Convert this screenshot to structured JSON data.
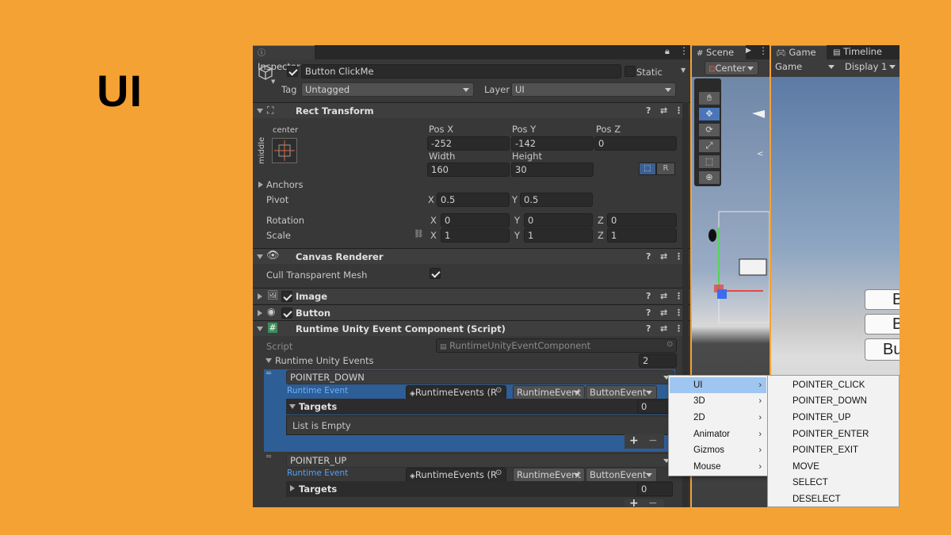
{
  "slide": {
    "title": "UI"
  },
  "inspector": {
    "tab_label": "Inspector",
    "object_name": "Button ClickMe",
    "static_label": "Static",
    "tag_label": "Tag",
    "tag_value": "Untagged",
    "layer_label": "Layer",
    "layer_value": "UI"
  },
  "rect_transform": {
    "title": "Rect Transform",
    "anchor_h": "center",
    "anchor_v": "middle",
    "pos_x_label": "Pos X",
    "pos_x": "-252",
    "pos_y_label": "Pos Y",
    "pos_y": "-142",
    "pos_z_label": "Pos Z",
    "pos_z": "0",
    "width_label": "Width",
    "width": "160",
    "height_label": "Height",
    "height": "30",
    "r_button": "R",
    "anchors_label": "Anchors",
    "pivot_label": "Pivot",
    "pivot_x": "0.5",
    "pivot_y": "0.5",
    "rotation_label": "Rotation",
    "rot_x": "0",
    "rot_y": "0",
    "rot_z": "0",
    "scale_label": "Scale",
    "scale_x": "1",
    "scale_y": "1",
    "scale_z": "1",
    "x": "X",
    "y": "Y",
    "z": "Z"
  },
  "canvas_renderer": {
    "title": "Canvas Renderer",
    "cull_label": "Cull Transparent Mesh"
  },
  "image_component": {
    "title": "Image"
  },
  "button_component": {
    "title": "Button"
  },
  "runtime_component": {
    "title": "Runtime Unity Event Component (Script)",
    "script_label": "Script",
    "script_value": "RuntimeUnityEventComponent",
    "events_label": "Runtime Unity Events",
    "events_count": "2",
    "events": [
      {
        "type": "POINTER_DOWN",
        "runtime_event_label": "Runtime Event",
        "object_field": "RuntimeEvents (R",
        "dropdown1": "RuntimeEvent",
        "dropdown2": "ButtonEvent",
        "targets_label": "Targets",
        "targets_count": "0",
        "empty_text": "List is Empty"
      },
      {
        "type": "POINTER_UP",
        "runtime_event_label": "Runtime Event",
        "object_field": "RuntimeEvents (R",
        "dropdown1": "RuntimeEvent",
        "dropdown2": "ButtonEvent",
        "targets_label": "Targets",
        "targets_count": "0"
      }
    ]
  },
  "scene": {
    "tab_label": "Scene",
    "pivot_dropdown": "Center"
  },
  "game": {
    "tab_label": "Game",
    "timeline_tab": "Timeline",
    "game_dropdown": "Game",
    "display_dropdown": "Display 1",
    "buttons": [
      "B",
      "B",
      "Bu"
    ]
  },
  "menu": {
    "categories": [
      "UI",
      "3D",
      "2D",
      "Animator",
      "Gizmos",
      "Mouse"
    ],
    "ui_events": [
      "POINTER_CLICK",
      "POINTER_DOWN",
      "POINTER_UP",
      "POINTER_ENTER",
      "POINTER_EXIT",
      "MOVE",
      "SELECT",
      "DESELECT"
    ]
  },
  "colors": {
    "background": "#f5a234",
    "editor_panel": "#383838",
    "selection_blue": "#2d5e96",
    "menu_highlight": "#9fc6f0",
    "link_blue": "#4da3ff"
  }
}
